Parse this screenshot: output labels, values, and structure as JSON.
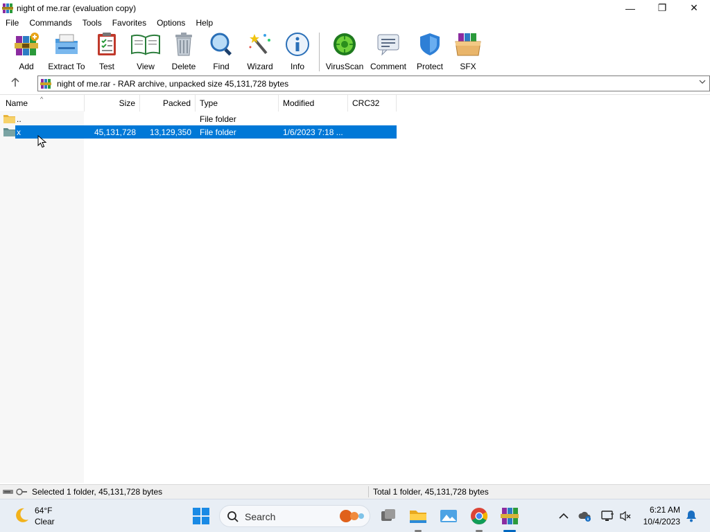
{
  "window": {
    "title": "night of me.rar (evaluation copy)",
    "minimize_glyph": "—",
    "restore_glyph": "❐",
    "close_glyph": "✕"
  },
  "menu": [
    "File",
    "Commands",
    "Tools",
    "Favorites",
    "Options",
    "Help"
  ],
  "toolbar": [
    {
      "label": "Add",
      "icon": "add-archive-icon"
    },
    {
      "label": "Extract To",
      "icon": "extract-folder-icon"
    },
    {
      "label": "Test",
      "icon": "test-clipboard-icon"
    },
    {
      "label": "View",
      "icon": "view-book-icon"
    },
    {
      "label": "Delete",
      "icon": "trash-icon"
    },
    {
      "label": "Find",
      "icon": "magnifier-icon"
    },
    {
      "label": "Wizard",
      "icon": "magic-wand-icon"
    },
    {
      "label": "Info",
      "icon": "info-icon"
    },
    {
      "label": "VirusScan",
      "icon": "virus-icon"
    },
    {
      "label": "Comment",
      "icon": "comment-icon"
    },
    {
      "label": "Protect",
      "icon": "shield-icon"
    },
    {
      "label": "SFX",
      "icon": "sfx-box-icon"
    }
  ],
  "address": {
    "text": "night of me.rar - RAR archive, unpacked size 45,131,728 bytes"
  },
  "columns": {
    "name": "Name",
    "size": "Size",
    "packed": "Packed",
    "type": "Type",
    "modified": "Modified",
    "crc": "CRC32"
  },
  "rows": [
    {
      "name": "..",
      "size": "",
      "packed": "",
      "type": "File folder",
      "modified": "",
      "crc": ""
    },
    {
      "name": "x",
      "size": "45,131,728",
      "packed": "13,129,350",
      "type": "File folder",
      "modified": "1/6/2023 7:18 ...",
      "crc": "",
      "selected": true
    }
  ],
  "status": {
    "left": "Selected 1 folder, 45,131,728 bytes",
    "right": "Total 1 folder, 45,131,728 bytes"
  },
  "taskbar": {
    "weather_temp": "64°F",
    "weather_condition": "Clear",
    "search_label": "Search",
    "time": "6:21 AM",
    "date": "10/4/2023"
  },
  "colors": {
    "selection": "#0078d7",
    "taskbar_bg": "#e8eef5"
  }
}
